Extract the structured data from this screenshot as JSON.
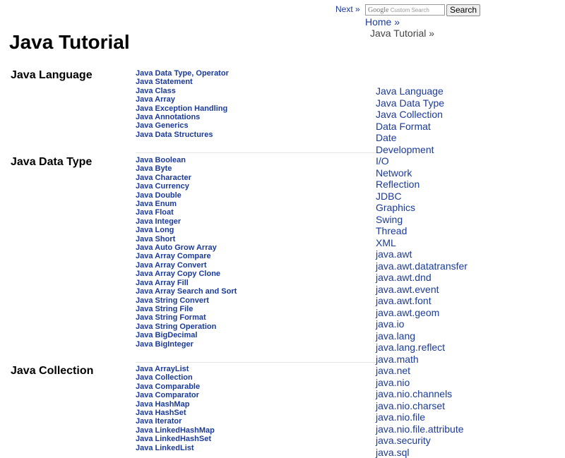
{
  "header": {
    "next_label": "Next »",
    "search_logo": "Google",
    "search_placeholder": "Custom Search",
    "search_button": "Search"
  },
  "breadcrumb": {
    "home": "Home »",
    "current": "Java Tutorial »"
  },
  "page_title": "Java Tutorial",
  "sections": [
    {
      "title": "Java Language",
      "links": [
        "Java Data Type, Operator",
        "Java Statement",
        "Java Class",
        "Java Array",
        "Java Exception Handling",
        "Java Annotations",
        "Java Generics",
        "Java Data Structures"
      ]
    },
    {
      "title": "Java Data Type",
      "links": [
        "Java Boolean",
        "Java Byte",
        "Java Character",
        "Java Currency",
        "Java Double",
        "Java Enum",
        "Java Float",
        "Java Integer",
        "Java Long",
        "Java Short",
        "Java Auto Grow Array",
        "Java Array Compare",
        "Java Array Convert",
        "Java Array Copy Clone",
        "Java Array Fill",
        "Java Array Search and Sort",
        "Java String Convert",
        "Java String File",
        "Java String Format",
        "Java String Operation",
        "Java BigDecimal",
        "Java BigInteger"
      ]
    },
    {
      "title": "Java Collection",
      "links": [
        "Java ArrayList",
        "Java Collection",
        "Java Comparable",
        "Java Comparator",
        "Java HashMap",
        "Java HashSet",
        "Java Iterator",
        "Java LinkedHashMap",
        "Java LinkedHashSet",
        "Java LinkedList"
      ]
    }
  ],
  "right_nav": [
    "Java Language",
    "Java Data Type",
    "Java Collection",
    "Data Format",
    "Date",
    "Development",
    "I/O",
    "Network",
    "Reflection",
    "JDBC",
    "Graphics",
    "Swing",
    "Thread",
    "XML",
    "java.awt",
    "java.awt.datatransfer",
    "java.awt.dnd",
    "java.awt.event",
    "java.awt.font",
    "java.awt.geom",
    "java.io",
    "java.lang",
    "java.lang.reflect",
    "java.math",
    "java.net",
    "java.nio",
    "java.nio.channels",
    "java.nio.charset",
    "java.nio.file",
    "java.nio.file.attribute",
    "java.security",
    "java.sql"
  ]
}
